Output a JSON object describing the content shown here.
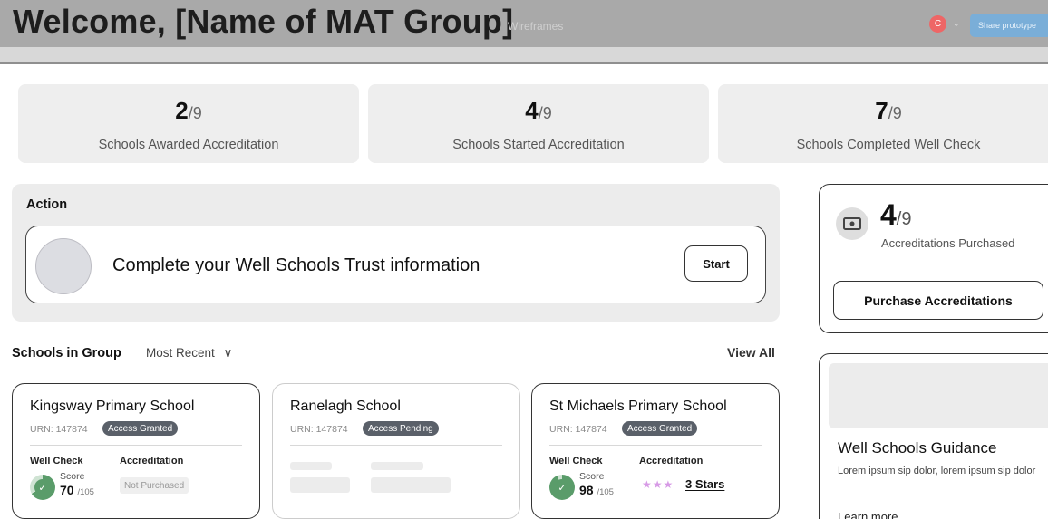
{
  "header": {
    "title": "Welcome, [Name of MAT Group]",
    "center_label": "Wireframes",
    "avatar_letter": "C",
    "avatar_caret": "⌄",
    "share_label": "Share prototype"
  },
  "stats": [
    {
      "value": "2",
      "total": "/9",
      "label": "Schools Awarded Accreditation"
    },
    {
      "value": "4",
      "total": "/9",
      "label": "Schools Started Accreditation"
    },
    {
      "value": "7",
      "total": "/9",
      "label": "Schools Completed Well Check"
    }
  ],
  "action": {
    "title": "Action",
    "text": "Complete your Well Schools Trust information",
    "button": "Start"
  },
  "purchase": {
    "value": "4",
    "total": "/9",
    "label": "Accreditations Purchased",
    "button": "Purchase Accreditations"
  },
  "guidance": {
    "title": "Well Schools Guidance",
    "body": "Lorem ipsum sip dolor, lorem ipsum sip dolor",
    "link": "Learn more"
  },
  "schools_section": {
    "title": "Schools in Group",
    "sort": "Most Recent",
    "sort_caret": "∨",
    "view_all": "View All"
  },
  "schools": [
    {
      "name": "Kingsway Primary School",
      "urn": "URN: 147874",
      "status": "Access Granted",
      "well_check_label": "Well Check",
      "accreditation_label": "Accreditation",
      "score_label": "Score",
      "score": "70",
      "score_total": "/105",
      "accreditation": "Not Purchased"
    },
    {
      "name": "Ranelagh School",
      "urn": "URN: 147874",
      "status": "Access Pending"
    },
    {
      "name": "St Michaels Primary School",
      "urn": "URN: 147874",
      "status": "Access Granted",
      "well_check_label": "Well Check",
      "accreditation_label": "Accreditation",
      "score_label": "Score",
      "score": "98",
      "score_total": "/105",
      "stars": "★★★",
      "accreditation": "3 Stars"
    }
  ],
  "colors": {
    "header_bg": "#a9a9a9",
    "badge_bg": "#5a6069",
    "score_green": "#5a9c6a",
    "star_color": "#d79be6",
    "share_button": "#7aaed8"
  }
}
